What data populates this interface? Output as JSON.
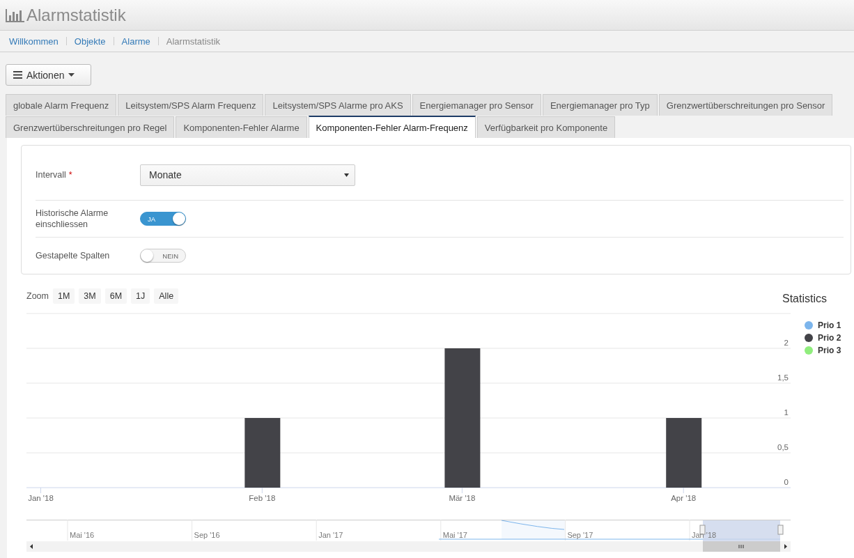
{
  "header": {
    "title": "Alarmstatistik"
  },
  "breadcrumb": [
    {
      "label": "Willkommen",
      "current": false
    },
    {
      "label": "Objekte",
      "current": false
    },
    {
      "label": "Alarme",
      "current": false
    },
    {
      "label": "Alarmstatistik",
      "current": true
    }
  ],
  "actions_button": {
    "label": "Aktionen"
  },
  "tab_rows": [
    [
      {
        "label": "globale Alarm Frequenz",
        "selected": false
      },
      {
        "label": "Leitsystem/SPS Alarm Frequenz",
        "selected": false
      },
      {
        "label": "Leitsystem/SPS Alarme pro AKS",
        "selected": false
      },
      {
        "label": "Energiemanager pro Sensor",
        "selected": false
      },
      {
        "label": "Energiemanager pro Typ",
        "selected": false
      },
      {
        "label": "Grenzwertüberschreitungen pro Sensor",
        "selected": false
      }
    ],
    [
      {
        "label": "Grenzwertüberschreitungen pro Regel",
        "selected": false
      },
      {
        "label": "Komponenten-Fehler Alarme",
        "selected": false
      },
      {
        "label": "Komponenten-Fehler Alarm-Frequenz",
        "selected": true
      },
      {
        "label": "Verfügbarkeit pro Komponente",
        "selected": false
      }
    ]
  ],
  "form": [
    {
      "kind": "select",
      "label": "Intervall",
      "required_mark": "*",
      "value": "Monate"
    },
    {
      "kind": "toggle",
      "label": "Historische Alarme einschliessen",
      "on": true,
      "state_label": "JA"
    },
    {
      "kind": "toggle",
      "label": "Gestapelte Spalten",
      "on": false,
      "state_label": "NEIN"
    }
  ],
  "zoom": {
    "label": "Zoom",
    "buttons": [
      "1M",
      "3M",
      "6M",
      "1J",
      "Alle"
    ]
  },
  "chart_data": {
    "type": "bar",
    "title": "Statistics",
    "x": [
      "2018-02-01",
      "2018-03-01",
      "2018-04-01"
    ],
    "xlim": [
      "2017-12-30",
      "2018-04-16"
    ],
    "grid": true,
    "xticks": [
      {
        "value": "2018-01-01",
        "label": "Jan '18"
      },
      {
        "value": "2018-02-01",
        "label": "Feb '18"
      },
      {
        "value": "2018-03-01",
        "label": "Mär '18"
      },
      {
        "value": "2018-04-01",
        "label": "Apr '18"
      }
    ],
    "ylim": [
      0,
      2.5
    ],
    "yticks": [
      {
        "value": 0,
        "label": "0"
      },
      {
        "value": 0.5,
        "label": "0,5"
      },
      {
        "value": 1,
        "label": "1"
      },
      {
        "value": 1.5,
        "label": "1,5"
      },
      {
        "value": 2,
        "label": "2"
      }
    ],
    "series": [
      {
        "name": "Prio 1",
        "color": "#7cb5ec",
        "values": [
          null,
          null,
          null
        ]
      },
      {
        "name": "Prio 2",
        "color": "#434348",
        "values": [
          1,
          2,
          1
        ]
      },
      {
        "name": "Prio 3",
        "color": "#90ed7d",
        "values": [
          null,
          null,
          null
        ]
      }
    ]
  },
  "navigator": {
    "labels": [
      "Mai '16",
      "Sep '16",
      "Jan '17",
      "Mai '17",
      "Sep '17",
      "Jan '18"
    ]
  }
}
